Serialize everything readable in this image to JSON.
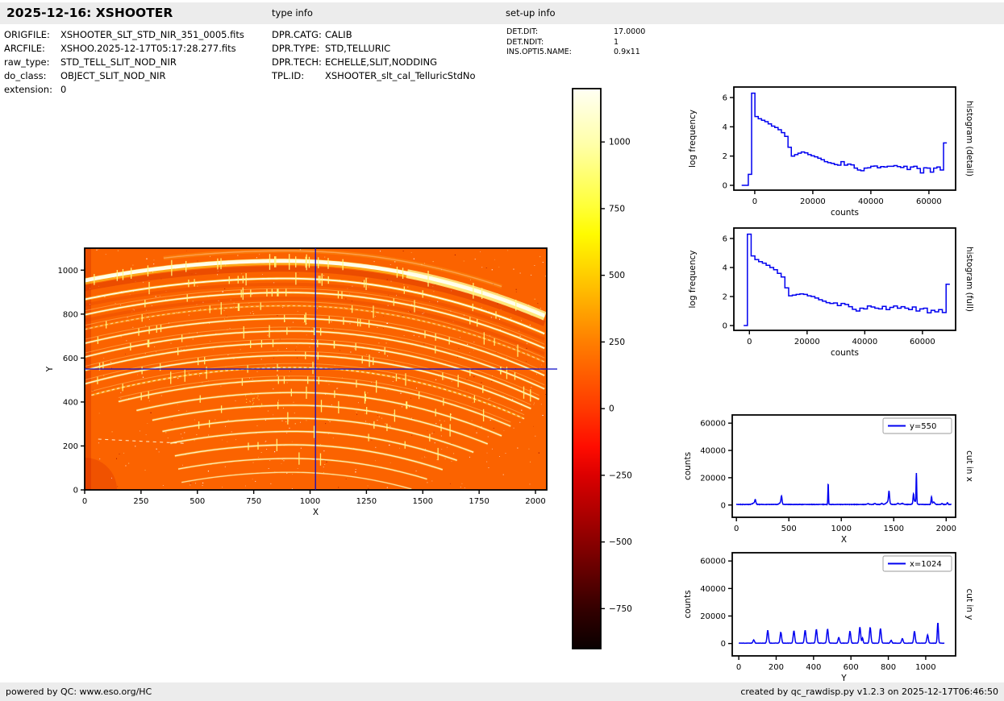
{
  "page": {
    "bg": "#ffffff",
    "bar_bg": "#ececec",
    "text_color": "#000000"
  },
  "header": {
    "title": "2025-12-16: XSHOOTER",
    "sections": [
      {
        "label": "type info"
      },
      {
        "label": "set-up info"
      }
    ],
    "file_info": [
      {
        "label": "ORIGFILE:",
        "value": "XSHOOTER_SLT_STD_NIR_351_0005.fits"
      },
      {
        "label": "ARCFILE:",
        "value": "XSHOO.2025-12-17T05:17:28.277.fits"
      },
      {
        "label": "raw_type:",
        "value": "STD_TELL_SLIT_NOD_NIR"
      },
      {
        "label": "do_class:",
        "value": "OBJECT_SLIT_NOD_NIR"
      },
      {
        "label": "extension:",
        "value": "0"
      }
    ],
    "type_info": [
      {
        "label": "DPR.CATG:",
        "value": "CALIB"
      },
      {
        "label": "DPR.TYPE:",
        "value": "STD,TELLURIC"
      },
      {
        "label": "DPR.TECH:",
        "value": "ECHELLE,SLIT,NODDING"
      },
      {
        "label": "TPL.ID:",
        "value": "XSHOOTER_slt_cal_TelluricStdNo"
      }
    ],
    "setup_info": [
      {
        "label": "DET.DIT:",
        "value": "17.0000"
      },
      {
        "label": "DET.NDIT:",
        "value": "1"
      },
      {
        "label": "INS.OPTI5.NAME:",
        "value": "0.9x11"
      }
    ]
  },
  "footer": {
    "left": "powered by QC: www.eso.org/HC",
    "right": "created by qc_rawdisp.py v1.2.3 on 2025-12-17T06:46:50"
  },
  "chart_data": [
    {
      "id": "raw_frame",
      "type": "heatmap",
      "title": "XSHOOTER NIR raw echelle frame (hot colormap): 16 curved spectral orders with sky emission ticks, crosshair cuts at x=1024 and y=550",
      "xlabel": "X",
      "ylabel": "Y",
      "xlim": [
        0,
        2050
      ],
      "ylim": [
        0,
        1100
      ],
      "xticks": [
        0,
        250,
        500,
        750,
        1000,
        1250,
        1500,
        1750,
        2000
      ],
      "yticks": [
        0,
        200,
        400,
        600,
        800,
        1000
      ],
      "crosshair": {
        "x": 1024,
        "y": 550,
        "color": "#0a0ac8"
      },
      "colors": {
        "background": "#fb6300",
        "glow": "#ffee32",
        "core": "#fffdee",
        "shadow": "rgba(222,58,0,0.55)",
        "tick": "rgba(255,250,130,0.9)",
        "speckle_white": "#ffffff",
        "speckle_yellow": "#ffd585",
        "speckle_dark": "#a01000"
      },
      "seed": 20251216,
      "orders": [
        [
          880,
          1038,
          1.15,
          1.85,
          0,
          2048,
          2.6,
          8.0,
          1.0,
          26,
          0
        ],
        [
          900,
          1088,
          1.1,
          1.8,
          350,
          1850,
          1.4,
          5.0,
          0.3,
          0,
          0
        ],
        [
          890,
          962,
          1.2,
          1.9,
          0,
          2048,
          1.8,
          3.6,
          0.95,
          18,
          0
        ],
        [
          900,
          898,
          1.25,
          1.95,
          0,
          2048,
          1.6,
          3.2,
          0.9,
          16,
          0
        ],
        [
          910,
          838,
          1.3,
          2.0,
          0,
          2048,
          1.2,
          2.6,
          0.55,
          12,
          1
        ],
        [
          915,
          780,
          1.35,
          2.05,
          0,
          2048,
          1.5,
          3.0,
          0.85,
          16,
          0
        ],
        [
          920,
          723,
          1.4,
          2.1,
          0,
          2048,
          1.5,
          3.0,
          0.85,
          15,
          0
        ],
        [
          925,
          668,
          1.45,
          2.15,
          0,
          2020,
          1.5,
          3.0,
          0.85,
          14,
          0
        ],
        [
          930,
          612,
          1.5,
          2.2,
          0,
          1990,
          1.5,
          3.0,
          0.85,
          13,
          0
        ],
        [
          932,
          557,
          1.55,
          2.25,
          30,
          1950,
          1.3,
          2.6,
          0.7,
          10,
          1
        ],
        [
          934,
          500,
          1.6,
          2.3,
          150,
          1900,
          1.4,
          3.0,
          0.8,
          12,
          0
        ],
        [
          934,
          443,
          1.65,
          2.35,
          230,
          1850,
          1.4,
          3.0,
          0.8,
          10,
          0
        ],
        [
          932,
          385,
          1.7,
          2.4,
          300,
          1790,
          1.4,
          3.0,
          0.8,
          8,
          0
        ],
        [
          930,
          326,
          1.75,
          2.45,
          345,
          1730,
          1.4,
          3.0,
          0.8,
          6,
          0
        ],
        [
          926,
          266,
          1.8,
          2.5,
          380,
          1660,
          1.4,
          3.0,
          0.8,
          4,
          0
        ],
        [
          922,
          205,
          1.85,
          2.55,
          400,
          1590,
          1.4,
          3.0,
          0.8,
          3,
          0
        ],
        [
          918,
          143,
          1.9,
          2.6,
          415,
          1520,
          1.3,
          2.6,
          0.75,
          2,
          0
        ],
        [
          914,
          80,
          1.95,
          2.65,
          430,
          1450,
          1.2,
          2.2,
          0.65,
          0,
          0
        ]
      ]
    },
    {
      "id": "colorbar",
      "type": "colorbar",
      "vmin": -900,
      "vmax": 1200,
      "ticks": [
        1000,
        750,
        500,
        250,
        0,
        -250,
        -500,
        -750
      ],
      "tick_labels": [
        "1000",
        "750",
        "500",
        "250",
        "0",
        "−250",
        "−500",
        "−750"
      ],
      "stops": [
        [
          0,
          "#0a0000"
        ],
        [
          7,
          "#330000"
        ],
        [
          19,
          "#8a0000"
        ],
        [
          31,
          "#dc0000"
        ],
        [
          36,
          "#ff0c00"
        ],
        [
          43,
          "#ff3a00"
        ],
        [
          55,
          "#ff8000"
        ],
        [
          67,
          "#ffcf00"
        ],
        [
          74,
          "#fffb00"
        ],
        [
          79,
          "#ffff38"
        ],
        [
          90,
          "#ffffa8"
        ],
        [
          100,
          "#fffff4"
        ]
      ]
    },
    {
      "id": "hist_detail",
      "type": "step",
      "right_label": "histogram (detail)",
      "xlabel": "counts",
      "ylabel": "log frequency",
      "line_color": "#0000f0",
      "xlim": [
        -7200,
        69200
      ],
      "ylim": [
        -0.33,
        6.72
      ],
      "xticks": [
        0,
        20000,
        40000,
        60000
      ],
      "yticks": [
        0,
        2,
        4,
        6
      ],
      "x0": -4500,
      "dx": 1140,
      "values": [
        0,
        0,
        0.75,
        6.3,
        4.7,
        4.55,
        4.45,
        4.35,
        4.2,
        4.05,
        3.95,
        3.8,
        3.6,
        3.35,
        2.6,
        2.0,
        2.1,
        2.2,
        2.28,
        2.22,
        2.1,
        2.02,
        1.95,
        1.85,
        1.75,
        1.62,
        1.55,
        1.5,
        1.42,
        1.38,
        1.62,
        1.38,
        1.45,
        1.4,
        1.18,
        1.05,
        1.0,
        1.18,
        1.2,
        1.3,
        1.32,
        1.2,
        1.28,
        1.25,
        1.3,
        1.3,
        1.35,
        1.28,
        1.22,
        1.3,
        1.08,
        1.25,
        1.3,
        1.15,
        0.85,
        1.2,
        1.18,
        0.9,
        1.18,
        1.25,
        1.05,
        2.9
      ]
    },
    {
      "id": "hist_full",
      "type": "step",
      "right_label": "histogram (full)",
      "xlabel": "counts",
      "ylabel": "log frequency",
      "line_color": "#0000f0",
      "xlim": [
        -5400,
        71500
      ],
      "ylim": [
        -0.33,
        6.72
      ],
      "xticks": [
        0,
        20000,
        40000,
        60000
      ],
      "yticks": [
        0,
        2,
        4,
        6
      ],
      "x0": -2000,
      "dx": 1300,
      "values": [
        0,
        6.3,
        4.8,
        4.55,
        4.4,
        4.3,
        4.15,
        4.0,
        3.85,
        3.6,
        3.35,
        2.6,
        2.05,
        2.1,
        2.15,
        2.18,
        2.15,
        2.05,
        2.0,
        1.9,
        1.78,
        1.68,
        1.58,
        1.52,
        1.56,
        1.38,
        1.52,
        1.45,
        1.3,
        1.12,
        1.0,
        1.2,
        1.15,
        1.35,
        1.28,
        1.2,
        1.15,
        1.32,
        1.1,
        1.25,
        1.35,
        1.2,
        1.3,
        1.2,
        1.1,
        1.28,
        1.0,
        1.15,
        1.2,
        0.88,
        1.05,
        0.95,
        1.1,
        0.9,
        2.85
      ]
    },
    {
      "id": "cut_x",
      "type": "profile",
      "legend": "y=550",
      "xlabel": "X",
      "ylabel": "counts",
      "right_label": "cut in x",
      "line_color": "#0000f0",
      "xlim": [
        -40,
        2090
      ],
      "ylim": [
        -9000,
        66000
      ],
      "xticks": [
        0,
        500,
        1000,
        1500,
        2000
      ],
      "yticks": [
        0,
        20000,
        40000,
        60000
      ],
      "sample_range": [
        0,
        2048
      ],
      "baseline": 400,
      "noise": 130,
      "seed": 7,
      "peaks": [
        [
          168,
          1100,
          14
        ],
        [
          180,
          2900,
          5
        ],
        [
          420,
          1200,
          12
        ],
        [
          430,
          5400,
          5
        ],
        [
          875,
          15300,
          3
        ],
        [
          1255,
          550,
          9
        ],
        [
          1320,
          650,
          9
        ],
        [
          1385,
          750,
          8
        ],
        [
          1445,
          1900,
          16
        ],
        [
          1455,
          8200,
          5
        ],
        [
          1540,
          850,
          8
        ],
        [
          1580,
          700,
          12
        ],
        [
          1688,
          6200,
          4
        ],
        [
          1700,
          2400,
          14
        ],
        [
          1716,
          21700,
          3
        ],
        [
          1860,
          5500,
          4
        ],
        [
          1880,
          1700,
          10
        ],
        [
          1960,
          650,
          6
        ],
        [
          2012,
          1250,
          5
        ]
      ]
    },
    {
      "id": "cut_y",
      "type": "profile",
      "legend": "x=1024",
      "xlabel": "Y",
      "ylabel": "counts",
      "right_label": "cut in y",
      "line_color": "#0000f0",
      "xlim": [
        -35,
        1160
      ],
      "ylim": [
        -9000,
        66000
      ],
      "xticks": [
        0,
        200,
        400,
        600,
        800,
        1000
      ],
      "yticks": [
        0,
        20000,
        40000,
        60000
      ],
      "sample_range": [
        0,
        1100
      ],
      "baseline": 260,
      "noise": 110,
      "seed": 11,
      "peaks": [
        [
          80,
          2300,
          4
        ],
        [
          155,
          9200,
          4
        ],
        [
          225,
          7900,
          4
        ],
        [
          295,
          8900,
          4
        ],
        [
          355,
          9400,
          4
        ],
        [
          415,
          9900,
          4
        ],
        [
          475,
          10300,
          4
        ],
        [
          535,
          4100,
          4
        ],
        [
          595,
          8600,
          4
        ],
        [
          648,
          11700,
          4
        ],
        [
          662,
          3800,
          3
        ],
        [
          703,
          11400,
          4
        ],
        [
          758,
          10700,
          4
        ],
        [
          815,
          2000,
          4
        ],
        [
          875,
          3400,
          4
        ],
        [
          940,
          8600,
          4
        ],
        [
          1010,
          6000,
          4
        ],
        [
          1065,
          15200,
          3
        ]
      ]
    }
  ]
}
